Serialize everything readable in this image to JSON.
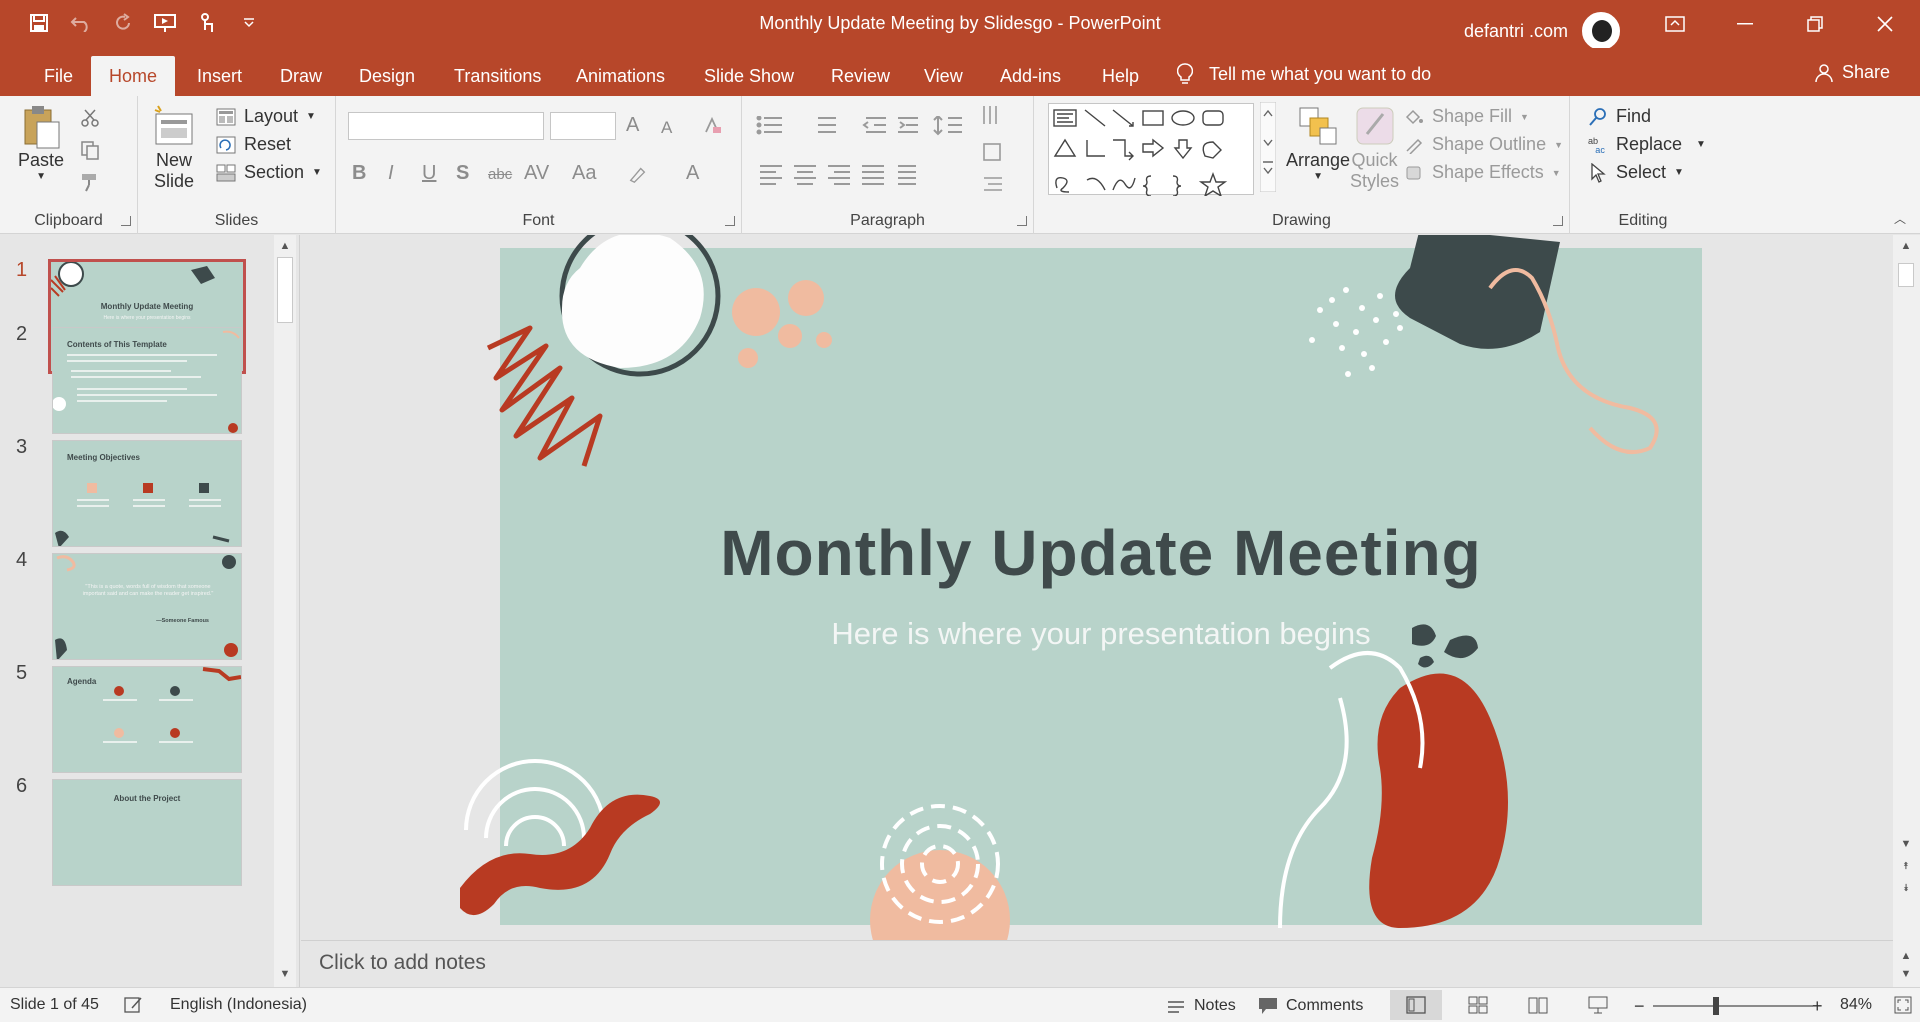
{
  "window": {
    "title": "Monthly Update Meeting by Slidesgo  -  PowerPoint",
    "user": "defantri .com"
  },
  "tabs": [
    "File",
    "Home",
    "Insert",
    "Draw",
    "Design",
    "Transitions",
    "Animations",
    "Slide Show",
    "Review",
    "View",
    "Add-ins",
    "Help"
  ],
  "active_tab": "Home",
  "tell_me": "Tell me what you want to do",
  "share": "Share",
  "ribbon": {
    "clipboard": {
      "label": "Clipboard",
      "paste": "Paste"
    },
    "slides": {
      "label": "Slides",
      "new_slide_1": "New",
      "new_slide_2": "Slide",
      "layout": "Layout",
      "reset": "Reset",
      "section": "Section"
    },
    "font": {
      "label": "Font",
      "bold": "B",
      "italic": "I",
      "underline": "U",
      "shadow": "S",
      "strike": "abc",
      "spacing": "AV",
      "case": "Aa",
      "grow": "A",
      "shrink": "A",
      "color": "A"
    },
    "paragraph": {
      "label": "Paragraph"
    },
    "drawing": {
      "label": "Drawing",
      "arrange": "Arrange",
      "quick_styles_1": "Quick",
      "quick_styles_2": "Styles",
      "shape_fill": "Shape Fill",
      "shape_outline": "Shape Outline",
      "shape_effects": "Shape Effects"
    },
    "editing": {
      "label": "Editing",
      "find": "Find",
      "replace": "Replace",
      "select": "Select"
    }
  },
  "thumbnails": [
    {
      "num": "1",
      "title": "Monthly Update Meeting",
      "sub": "Here is where your presentation begins"
    },
    {
      "num": "2",
      "title": "Contents of This Template"
    },
    {
      "num": "3",
      "title": "Meeting Objectives"
    },
    {
      "num": "4",
      "quote": "\"This is a quote, words full of wisdom that someone important said and can make the reader get inspired.\"",
      "author": "—Someone Famous"
    },
    {
      "num": "5",
      "title": "Agenda"
    },
    {
      "num": "6",
      "title": "About the Project"
    }
  ],
  "slide": {
    "title": "Monthly Update Meeting",
    "subtitle": "Here is where your presentation begins"
  },
  "notes_placeholder": "Click to add notes",
  "status": {
    "slide_count": "Slide 1 of 45",
    "language": "English (Indonesia)",
    "notes": "Notes",
    "comments": "Comments",
    "zoom": "84%"
  },
  "colors": {
    "accent": "#b7472a",
    "slide_bg": "#b8d3ca",
    "slide_title": "#3f4a4b",
    "red_shape": "#b83a22",
    "peach": "#f0bba0",
    "dark_shape": "#3d4a4b"
  }
}
